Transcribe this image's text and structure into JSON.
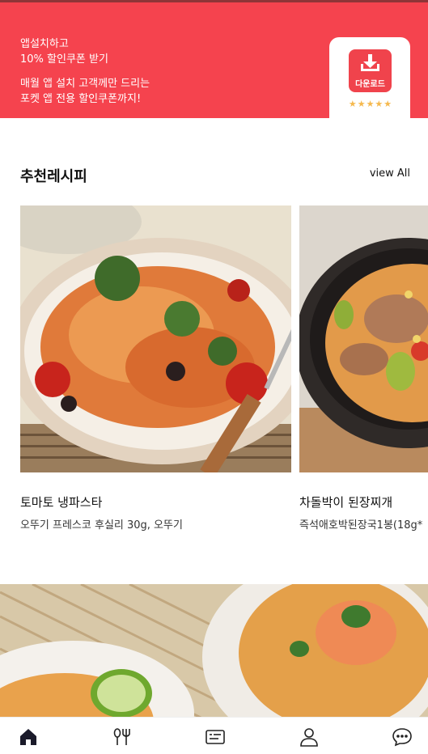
{
  "banner": {
    "line1": "앱설치하고",
    "line2": "10% 할인쿠폰 받기",
    "desc1": "매월 앱 설치 고객께만 드리는",
    "desc2": "포켓 앱 전용 할인쿠폰까지!",
    "download_label": "다운로드",
    "stars": "★★★★★",
    "accent": "#f5434e"
  },
  "section": {
    "title": "추천레시피",
    "view_all": "view All"
  },
  "recipes": [
    {
      "title": "토마토 냉파스타",
      "subtitle": "오뚜기 프레스코 후실리 30g, 오뚜기"
    },
    {
      "title": "차돌박이 된장찌개",
      "subtitle": "즉석애호박된장국1봉(18g*"
    }
  ],
  "tabbar": {
    "icons": [
      "home-icon",
      "utensils-icon",
      "list-icon",
      "user-icon",
      "chat-icon"
    ]
  }
}
